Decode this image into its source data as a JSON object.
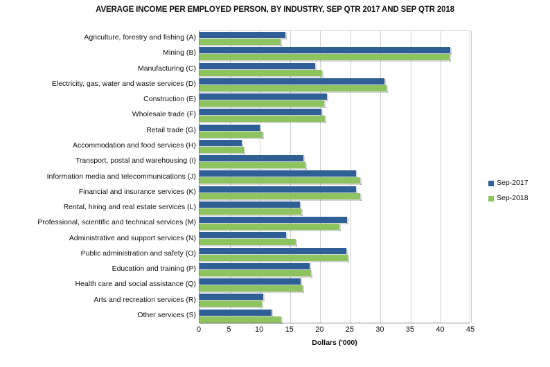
{
  "chart_data": {
    "type": "bar",
    "orientation": "horizontal",
    "title": "AVERAGE INCOME PER EMPLOYED PERSON, BY INDUSTRY, SEP QTR 2017 AND SEP QTR 2018",
    "xlabel": "Dollars ('000)",
    "ylabel": "",
    "xlim": [
      0,
      45
    ],
    "xticks": [
      0,
      5,
      10,
      15,
      20,
      25,
      30,
      35,
      40,
      45
    ],
    "grid": "vertical",
    "legend_position": "right",
    "categories": [
      "Agriculture, forestry and fishing (A)",
      "Mining (B)",
      "Manufacturing (C)",
      "Electricity, gas, water and waste services (D)",
      "Construction (E)",
      "Wholesale trade (F)",
      "Retail trade (G)",
      "Accommodation and food services (H)",
      "Transport, postal and warehousing (I)",
      "Information media and telecommunications (J)",
      "Financial and insurance services (K)",
      "Rental, hiring and real estate services (L)",
      "Professional, scientific and technical services (M)",
      "Administrative and support services (N)",
      "Public administration and safety (O)",
      "Education and training (P)",
      "Health care and social assistance (Q)",
      "Arts and recreation services (R)",
      "Other services (S)"
    ],
    "series": [
      {
        "name": "Sep-2017",
        "color": "#2E6096",
        "values": [
          14.2,
          41.6,
          19.2,
          30.6,
          21.1,
          20.2,
          10.0,
          7.0,
          17.2,
          26.0,
          25.9,
          16.6,
          24.4,
          14.4,
          24.3,
          18.3,
          16.8,
          10.6,
          11.9
        ]
      },
      {
        "name": "Sep-2018",
        "color": "#8DC460",
        "values": [
          13.4,
          41.4,
          20.3,
          31.0,
          20.7,
          20.8,
          10.4,
          7.3,
          17.6,
          26.6,
          26.6,
          16.9,
          23.2,
          15.9,
          24.6,
          18.5,
          17.1,
          10.3,
          13.5
        ]
      }
    ]
  }
}
